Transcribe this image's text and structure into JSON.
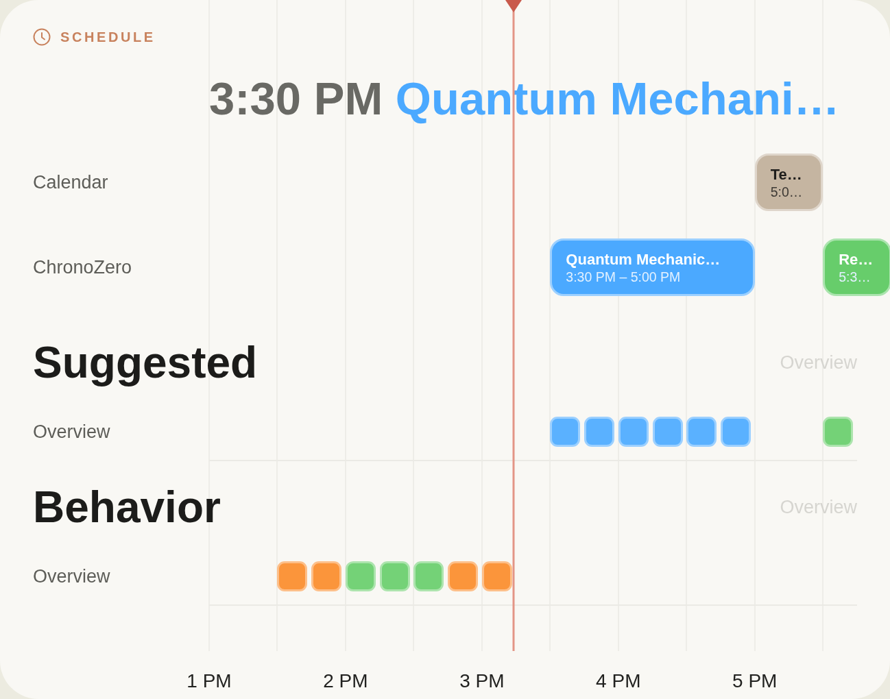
{
  "header": {
    "label": "SCHEDULE"
  },
  "current": {
    "time": "3:30 PM",
    "title": "Quantum Mechani…"
  },
  "now_marker": {
    "level": 0.47
  },
  "calendars": [
    {
      "label": "Calendar",
      "slots": [
        {
          "kind": "empty"
        },
        {
          "kind": "empty"
        },
        {
          "kind": "empty"
        },
        {
          "kind": "empty"
        },
        {
          "kind": "empty"
        },
        {
          "kind": "empty"
        },
        {
          "kind": "empty"
        },
        {
          "kind": "empty"
        },
        {
          "kind": "event",
          "title": "Te…",
          "time": "5:0…",
          "color": "#c5b5a1"
        }
      ]
    },
    {
      "label": "ChronoZero",
      "slots": [
        {
          "kind": "empty"
        },
        {
          "kind": "empty"
        },
        {
          "kind": "empty"
        },
        {
          "kind": "empty"
        },
        {
          "kind": "empty"
        },
        {
          "kind": "event",
          "title": "Quantum Mechanic…",
          "time": "3:30 PM – 5:00 PM",
          "color": "#4ba9ff"
        },
        {
          "kind": "continued"
        },
        {
          "kind": "continued"
        },
        {
          "kind": "empty"
        },
        {
          "kind": "event",
          "title": "Re…",
          "time": "5:3…",
          "color": "#67cd6b"
        }
      ]
    }
  ],
  "sections": [
    {
      "title": "Suggested",
      "link": {
        "label": "Overview",
        "disabled": true
      },
      "rows": [
        {
          "label": "Overview",
          "slots": [
            {
              "kind": "empty"
            },
            {
              "kind": "empty"
            },
            {
              "kind": "empty"
            },
            {
              "kind": "empty"
            },
            {
              "kind": "empty"
            },
            {
              "kind": "empty"
            },
            {
              "kind": "empty"
            },
            {
              "kind": "empty"
            },
            {
              "kind": "empty"
            },
            {
              "kind": "empty"
            },
            {
              "kind": "block",
              "color": "#5ab1ff"
            },
            {
              "kind": "block",
              "color": "#5ab1ff"
            },
            {
              "kind": "block",
              "color": "#5ab1ff"
            },
            {
              "kind": "block",
              "color": "#5ab1ff"
            },
            {
              "kind": "block",
              "color": "#5ab1ff"
            },
            {
              "kind": "block",
              "color": "#5ab1ff"
            },
            {
              "kind": "empty"
            },
            {
              "kind": "empty"
            },
            {
              "kind": "block",
              "color": "#74d277"
            }
          ]
        }
      ]
    },
    {
      "title": "Behavior",
      "link": {
        "label": "Overview",
        "disabled": true
      },
      "rows": [
        {
          "label": "Overview",
          "slots": [
            {
              "kind": "empty"
            },
            {
              "kind": "empty"
            },
            {
              "kind": "block",
              "color": "#fb953b"
            },
            {
              "kind": "block",
              "color": "#fb953b"
            },
            {
              "kind": "block",
              "color": "#74d277"
            },
            {
              "kind": "block",
              "color": "#74d277"
            },
            {
              "kind": "block",
              "color": "#74d277"
            },
            {
              "kind": "block",
              "color": "#fb953b"
            },
            {
              "kind": "block",
              "color": "#fb953b"
            }
          ]
        }
      ]
    }
  ],
  "axis": [
    "1 PM",
    "2 PM",
    "3 PM",
    "4 PM",
    "5 PM"
  ]
}
